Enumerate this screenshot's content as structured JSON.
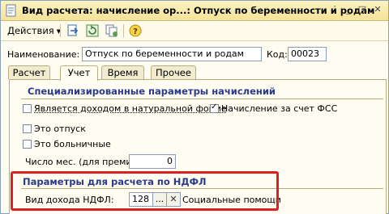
{
  "window": {
    "title": "Вид расчета: начисление ор...: Отпуск по беременности и родам",
    "controls": {
      "menu": "⋮",
      "minimize": "_",
      "maximize": "□",
      "close": "✕"
    }
  },
  "toolbar": {
    "actions_label": "Действия",
    "icons": [
      "go-to-icon",
      "refresh-icon",
      "copy-icon",
      "help-icon"
    ]
  },
  "header": {
    "name_label": "Наименование:",
    "name_value": "Отпуск по беременности и родам",
    "code_label": "Код:",
    "code_value": "00023"
  },
  "tabs": [
    {
      "label": "Расчет",
      "active": false
    },
    {
      "label": "Учет",
      "active": true
    },
    {
      "label": "Время",
      "active": false
    },
    {
      "label": "Прочее",
      "active": false
    }
  ],
  "specialized": {
    "title": "Специализированные параметры начислений",
    "natural_income": {
      "label": "Является доходом в натуральной форме",
      "checked": false
    },
    "fss": {
      "label": "Начисление за счет ФСС",
      "checked": true
    },
    "vacation": {
      "label": "Это отпуск",
      "checked": false
    },
    "sick_leave": {
      "label": "Это больничные",
      "checked": false
    },
    "months_label": "Число мес. (для премии):",
    "months_value": "0"
  },
  "ndfl": {
    "title": "Параметры для расчета по НДФЛ",
    "income_type_label": "Вид дохода НДФЛ:",
    "income_type_code": "128",
    "select_button": "...",
    "clear_button": "✕",
    "income_type_name": "Социальные помощи"
  },
  "colors": {
    "accent_red": "#e02020",
    "section_title": "#2a3a8a"
  }
}
